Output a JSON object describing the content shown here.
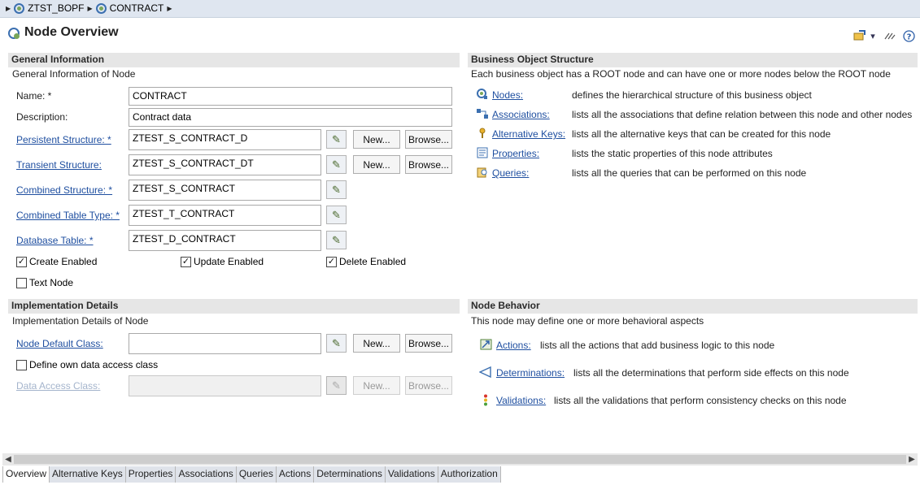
{
  "breadcrumb": {
    "items": [
      "ZTST_BOPF",
      "CONTRACT"
    ]
  },
  "header": {
    "title": "Node Overview"
  },
  "general": {
    "title": "General Information",
    "description": "General Information of Node",
    "name_label": "Name: *",
    "name_value": "CONTRACT",
    "desc_label": "Description:",
    "desc_value": "Contract data",
    "persistent_label": "Persistent Structure: *",
    "persistent_value": "ZTEST_S_CONTRACT_D",
    "transient_label": "Transient Structure:",
    "transient_value": "ZTEST_S_CONTRACT_DT",
    "combined_label": "Combined Structure: *",
    "combined_value": "ZTEST_S_CONTRACT",
    "table_type_label": "Combined Table Type: *",
    "table_type_value": "ZTEST_T_CONTRACT",
    "db_table_label": "Database Table: *",
    "db_table_value": "ZTEST_D_CONTRACT",
    "new_label": "New...",
    "browse_label": "Browse...",
    "create_enabled": "Create Enabled",
    "update_enabled": "Update Enabled",
    "delete_enabled": "Delete Enabled",
    "text_node": "Text Node"
  },
  "implementation": {
    "title": "Implementation Details",
    "description": "Implementation Details of Node",
    "default_class_label": "Node Default Class:",
    "default_class_value": "",
    "own_access_label": "Define own data access class",
    "access_class_label": "Data Access Class:",
    "access_class_value": "",
    "new_label": "New...",
    "browse_label": "Browse..."
  },
  "structure": {
    "title": "Business Object Structure",
    "description": "Each business object has a ROOT node and can have one or more nodes below the ROOT node",
    "items": [
      {
        "label": "Nodes:",
        "desc": "defines the hierarchical structure of this business object",
        "icon": "nodes-icon"
      },
      {
        "label": "Associations:",
        "desc": "lists all the associations that define relation between this node and other nodes",
        "icon": "associations-icon"
      },
      {
        "label": "Alternative Keys:",
        "desc": "lists all the alternative keys that can be created for this node",
        "icon": "key-icon"
      },
      {
        "label": "Properties:",
        "desc": "lists the static properties of this node attributes",
        "icon": "properties-icon"
      },
      {
        "label": "Queries:",
        "desc": "lists all the queries that can be performed on this node",
        "icon": "queries-icon"
      }
    ]
  },
  "behavior": {
    "title": "Node Behavior",
    "description": "This node may define one or more behavioral aspects",
    "items": [
      {
        "label": "Actions:",
        "desc": "lists all the actions that add business logic to this node",
        "icon": "actions-icon"
      },
      {
        "label": "Determinations:",
        "desc": "lists all the determinations that perform side effects on this node",
        "icon": "determinations-icon"
      },
      {
        "label": "Validations:",
        "desc": "lists all the validations that perform consistency checks on this node",
        "icon": "validations-icon"
      }
    ]
  },
  "tabs": [
    "Overview",
    "Alternative Keys",
    "Properties",
    "Associations",
    "Queries",
    "Actions",
    "Determinations",
    "Validations",
    "Authorization"
  ],
  "colors": {
    "link": "#1f4fa0",
    "section_header": "#e6e6e6",
    "breadcrumb_bg": "#dfe6f0"
  }
}
